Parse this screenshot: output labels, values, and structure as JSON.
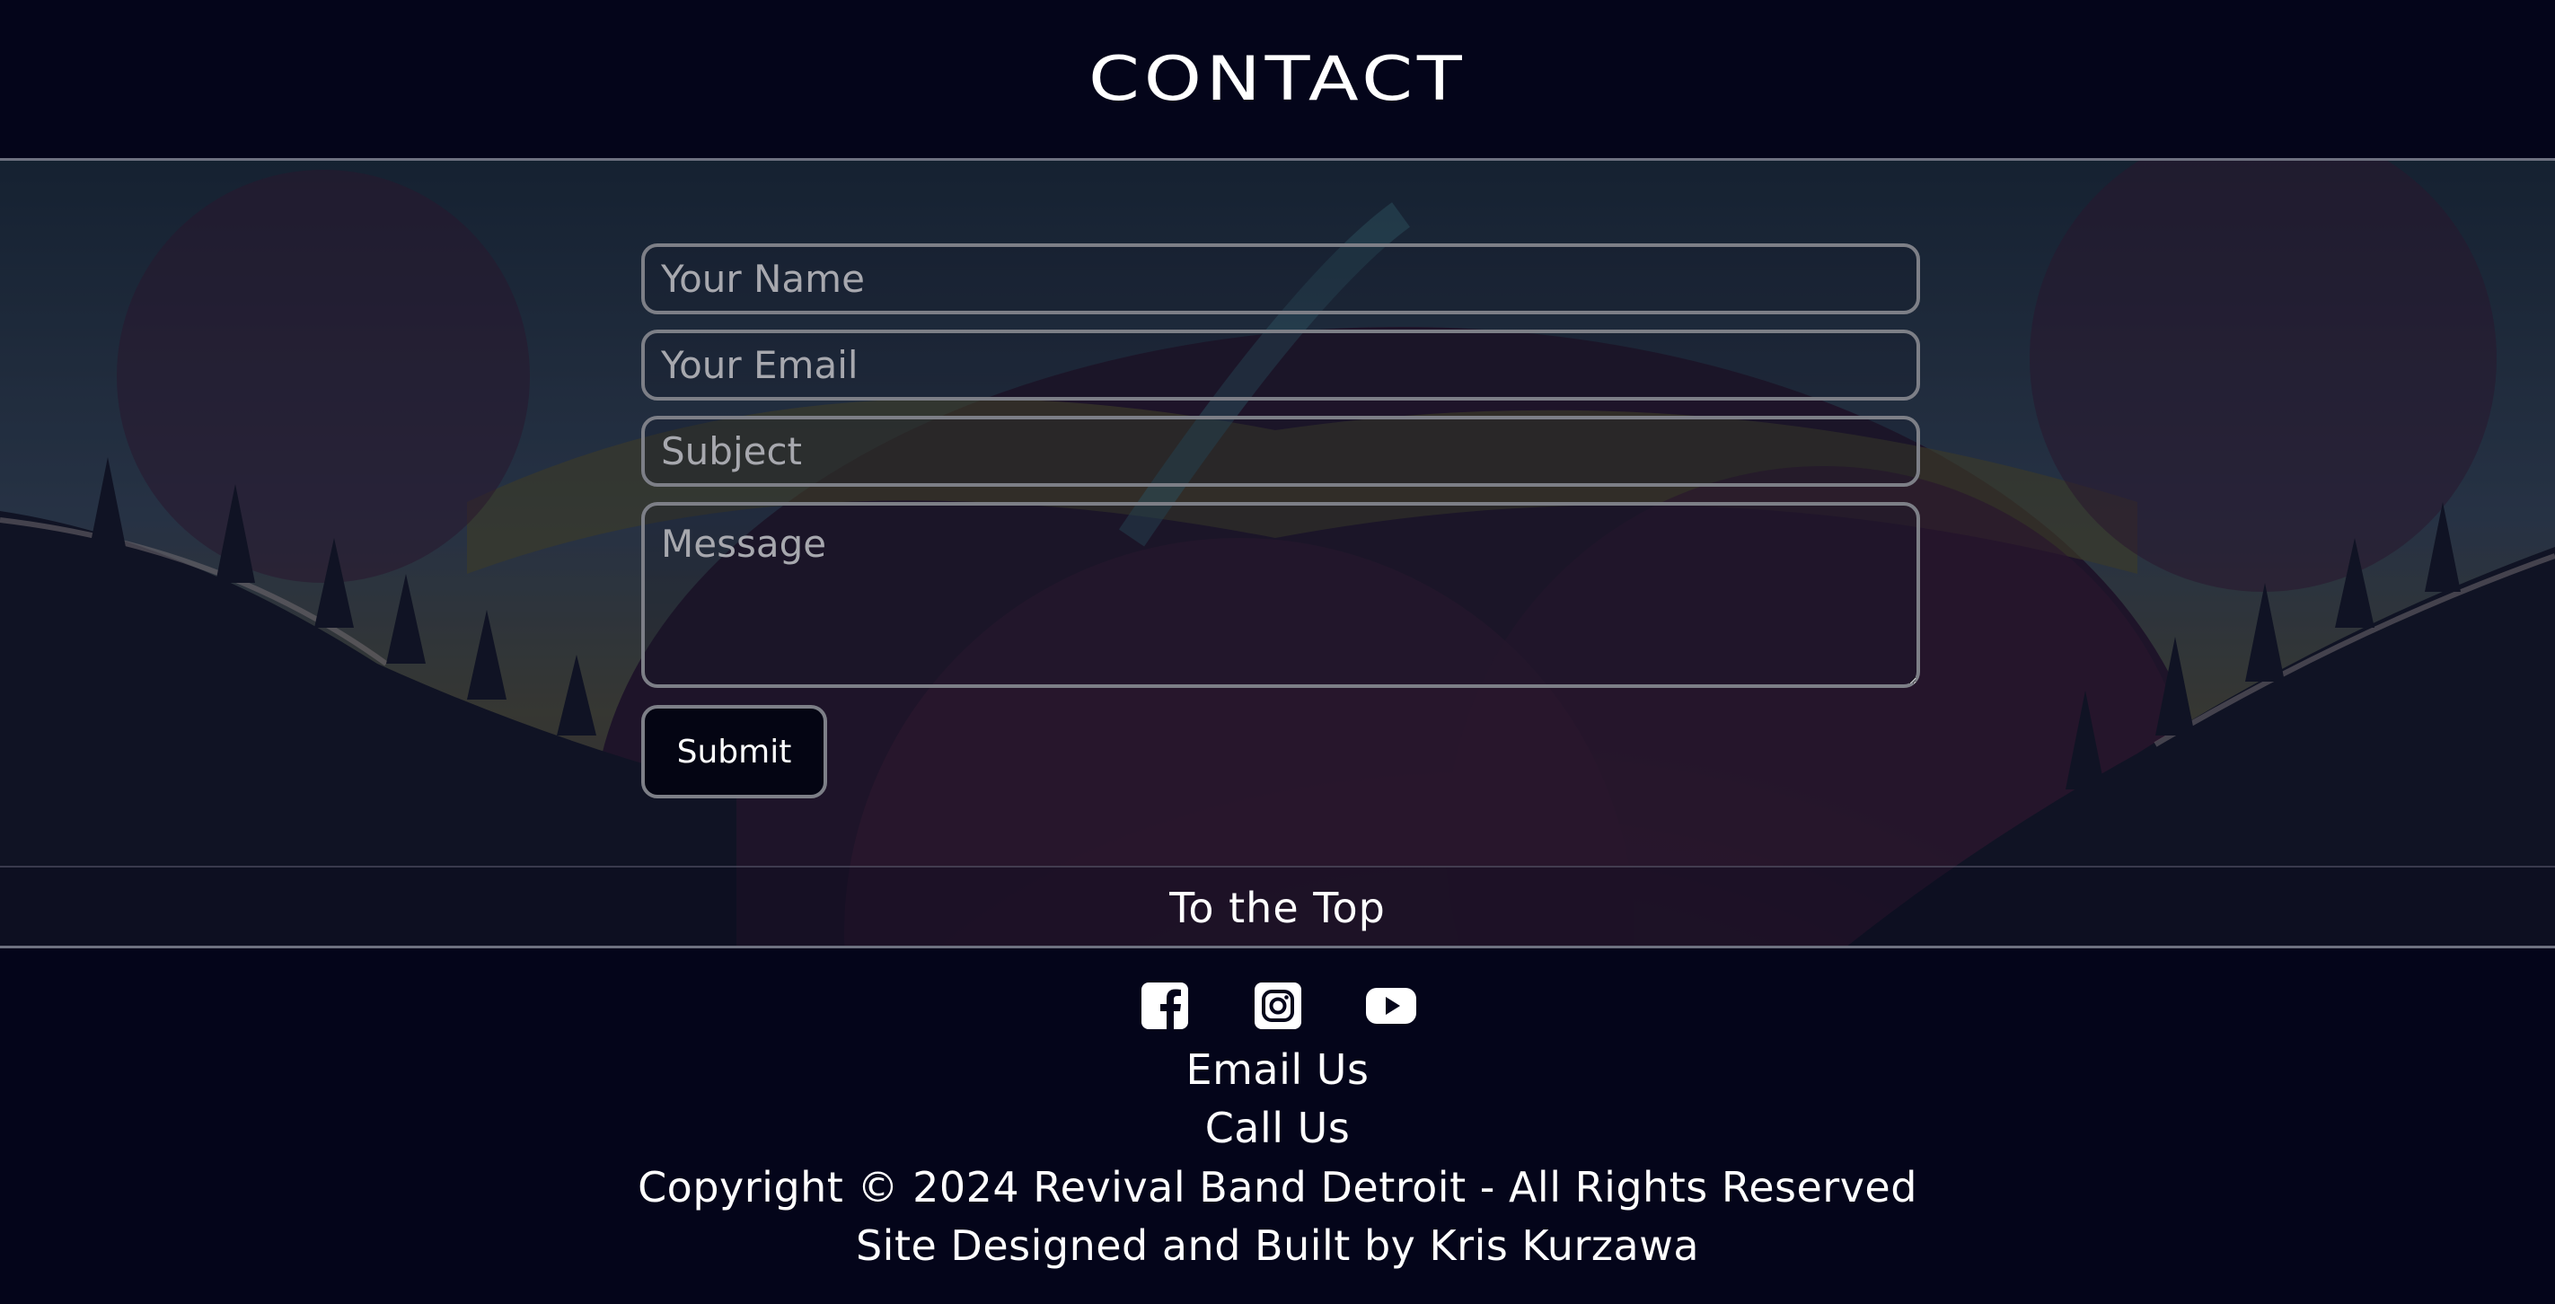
{
  "header": {
    "title": "CONTACT"
  },
  "form": {
    "name_placeholder": "Your Name",
    "email_placeholder": "Your Email",
    "subject_placeholder": "Subject",
    "message_placeholder": "Message",
    "submit_label": "Submit"
  },
  "navigation": {
    "to_top_label": "To the Top"
  },
  "footer": {
    "social": [
      {
        "icon": "facebook-icon"
      },
      {
        "icon": "instagram-icon"
      },
      {
        "icon": "youtube-icon"
      }
    ],
    "email_label": "Email Us",
    "call_label": "Call Us",
    "copyright": "Copyright © 2024 Revival Band Detroit - All Rights Reserved",
    "credit": "Site Designed and Built by Kris Kurzawa"
  },
  "colors": {
    "background": "#04051a",
    "border": "#7d7f87",
    "text": "#ffffff",
    "placeholder": "#a7a8ae"
  }
}
